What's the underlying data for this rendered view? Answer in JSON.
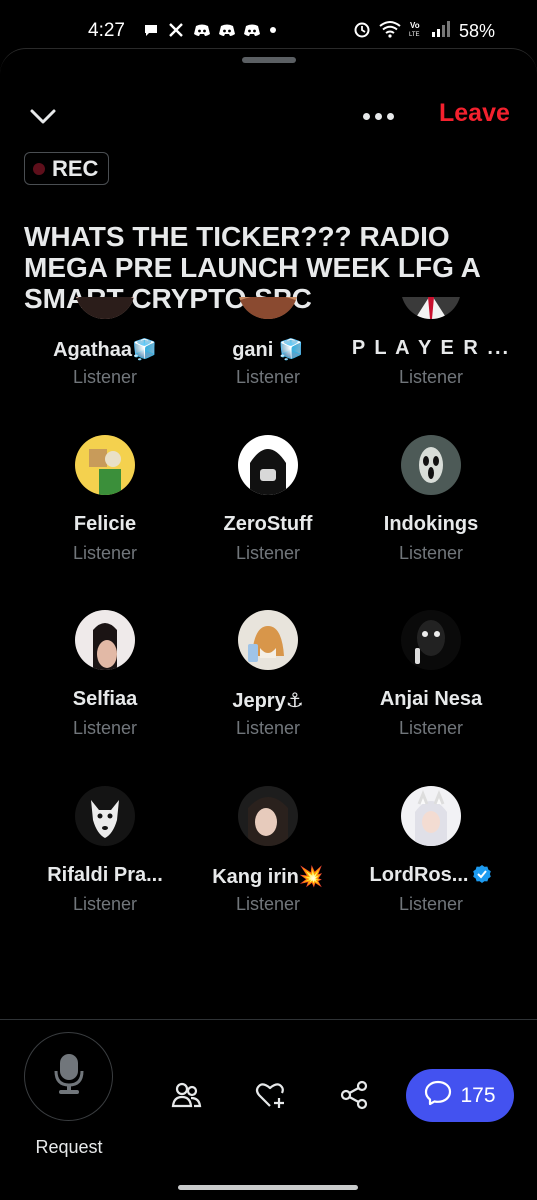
{
  "status_bar": {
    "time": "4:27",
    "battery": "58%",
    "network_label": "LTE",
    "notification_icons": [
      "chat-bubble-icon",
      "x-logo-icon",
      "discord-icon",
      "discord-icon",
      "discord-icon",
      "dot-icon"
    ],
    "system_icons": [
      "alarm-icon",
      "wifi-icon",
      "volte-icon",
      "signal-icon",
      "battery-label"
    ]
  },
  "header": {
    "leave_label": "Leave",
    "rec_label": "REC",
    "title": "WHATS THE TICKER??? RADIO MEGA PRE LAUNCH WEEK LFG A SMART CRYPTO SPC"
  },
  "participants": [
    {
      "name": "Agathaa🧊",
      "role": "Listener"
    },
    {
      "name": "gani 🧊",
      "role": "Listener"
    },
    {
      "name": "P L A Y E R ...",
      "role": "Listener"
    },
    {
      "name": "Felicie",
      "role": "Listener"
    },
    {
      "name": "ZeroStuff",
      "role": "Listener"
    },
    {
      "name": "Indokings",
      "role": "Listener"
    },
    {
      "name": "Selfiaa",
      "role": "Listener"
    },
    {
      "name": "Jepry⚓",
      "role": "Listener"
    },
    {
      "name": "Anjai Nesa",
      "role": "Listener"
    },
    {
      "name": "Rifaldi Pra...",
      "role": "Listener"
    },
    {
      "name": "Kang irin💥",
      "role": "Listener"
    },
    {
      "name": "LordRos...",
      "role": "Listener",
      "verified": true
    }
  ],
  "bottom_bar": {
    "request_label": "Request",
    "chat_count": "175",
    "icons": [
      "microphone-icon",
      "people-icon",
      "heart-add-icon",
      "share-icon",
      "chat-icon"
    ]
  },
  "colors": {
    "background": "#000000",
    "leave": "#f4212e",
    "secondary_text": "#71767b",
    "chat_pill": "#4352f0",
    "verified": "#1d9bf0"
  }
}
